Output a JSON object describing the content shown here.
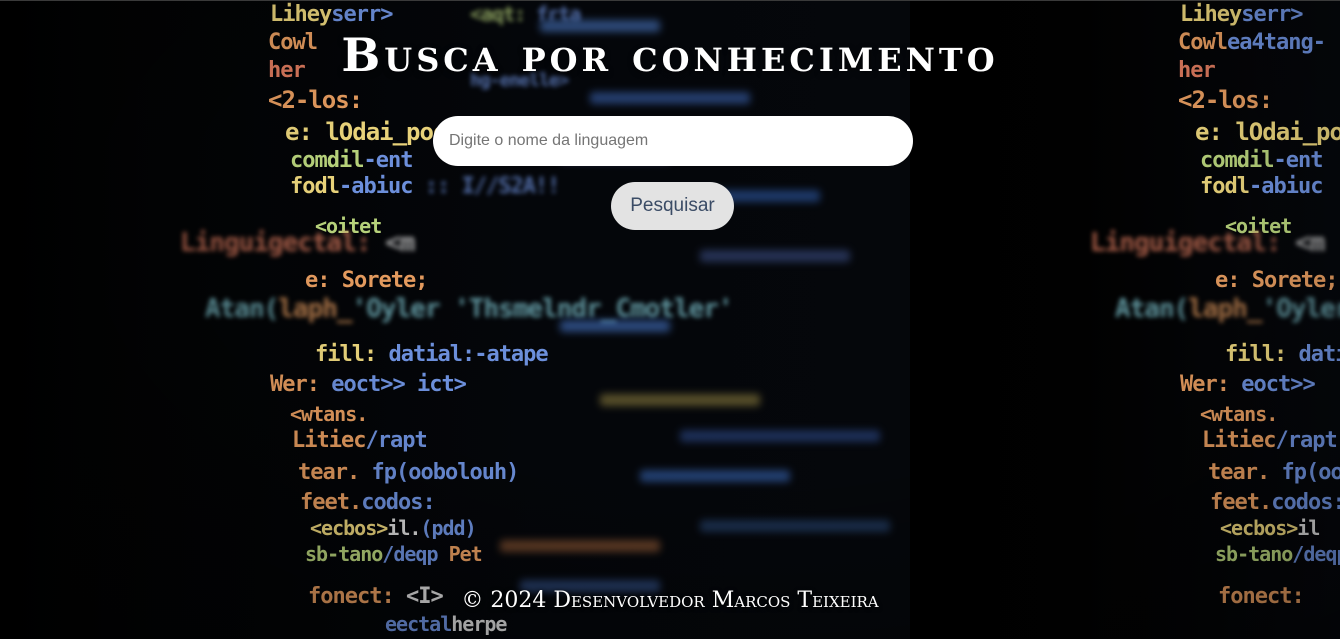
{
  "page": {
    "title": "Busca por conhecimento",
    "background_icon": "code-screen-image"
  },
  "search": {
    "placeholder": "Digite o nome da linguagem",
    "value": "",
    "button_label": "Pesquisar"
  },
  "footer": {
    "text": "© 2024 Desenvolvedor Marcos Teixeira"
  },
  "colors": {
    "background": "#000000",
    "title": "#ffffff",
    "input_bg": "#ffffff",
    "button_bg": "#e3e3e3",
    "button_text": "#3b4c66"
  }
}
